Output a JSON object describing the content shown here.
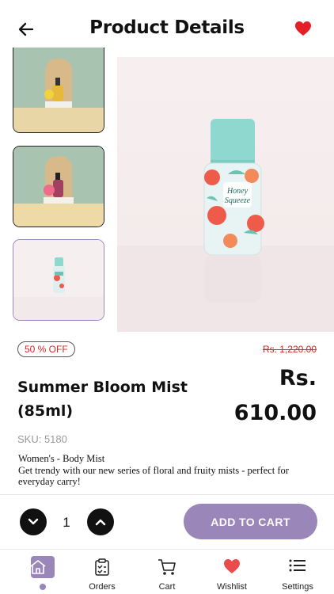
{
  "header": {
    "title": "Product Details",
    "back_icon": "arrow-left-icon",
    "wishlist_icon": "heart-icon",
    "wishlist_color": "#e61e28"
  },
  "gallery": {
    "thumbnails": [
      {
        "label": "thumbnail-1",
        "selected": false
      },
      {
        "label": "thumbnail-2",
        "selected": false
      },
      {
        "label": "thumbnail-3",
        "selected": true
      }
    ],
    "main_image_label": "Honey Squeeze"
  },
  "pricing": {
    "discount_badge": "50 % OFF",
    "old_price": "Rs. 1,220.00",
    "currency": "Rs.",
    "price": "610.00"
  },
  "product": {
    "name": "Summer Bloom Mist (85ml)",
    "sku": "SKU: 5180",
    "category": "Women's - Body Mist",
    "description": "Get trendy with our new series of floral and fruity mists - perfect for everyday carry!"
  },
  "cart": {
    "quantity": "1",
    "add_label": "ADD TO CART"
  },
  "nav": {
    "items": [
      {
        "label": "",
        "icon": "home-icon",
        "active": true
      },
      {
        "label": "Orders",
        "icon": "orders-icon"
      },
      {
        "label": "Cart",
        "icon": "cart-icon"
      },
      {
        "label": "Wishlist",
        "icon": "heart-icon"
      },
      {
        "label": "Settings",
        "icon": "menu-icon"
      }
    ]
  },
  "colors": {
    "accent": "#9a86b8",
    "sale_red": "#d62828"
  }
}
